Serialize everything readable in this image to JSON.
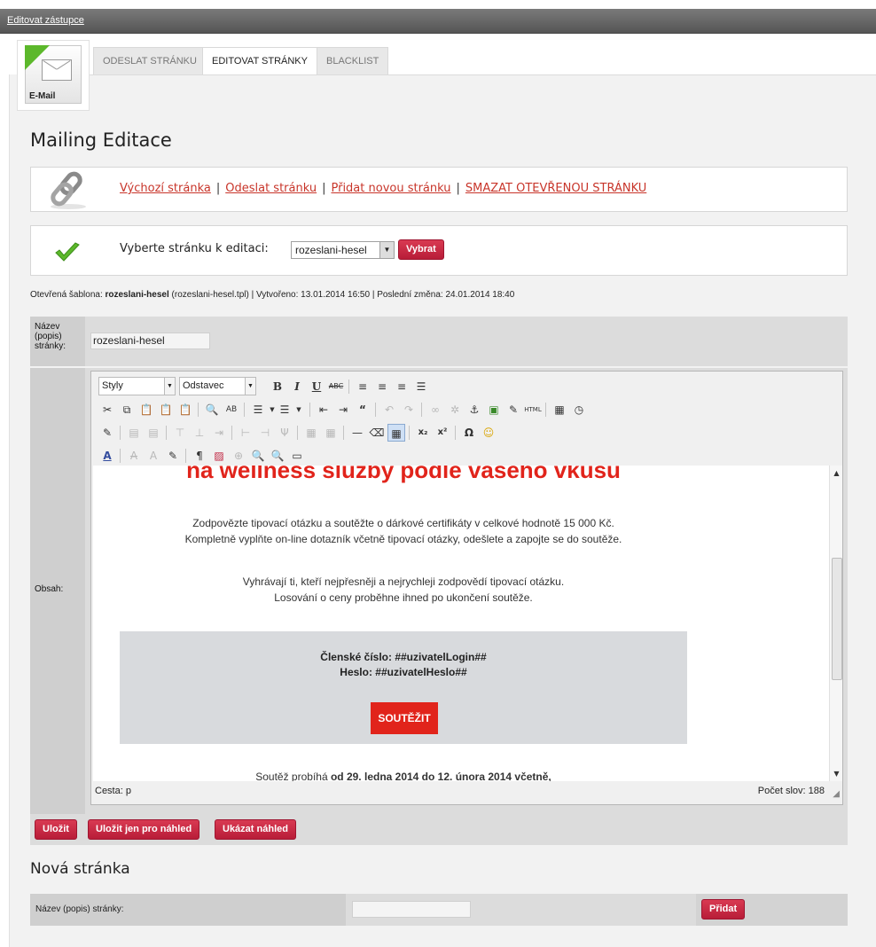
{
  "topbar": {
    "link": "Editovat zástupce"
  },
  "logo": {
    "label": "E-Mail"
  },
  "tabs": [
    {
      "label": "ODESLAT STRÁNKU",
      "active": false
    },
    {
      "label": "EDITOVAT STRÁNKY",
      "active": true
    },
    {
      "label": "BLACKLIST",
      "active": false
    }
  ],
  "page_title": "Mailing Editace",
  "links": {
    "items": [
      "Výchozí stránka",
      "Odeslat stránku",
      "Přidat novou stránku",
      "SMAZAT OTEVŘENOU STRÁNKU"
    ],
    "separator": "|"
  },
  "select_page": {
    "label": "Vyberte stránku k editaci:",
    "value": "rozeslani-hesel",
    "button": "Vybrat"
  },
  "info": {
    "label_template": "Otevřená šablona:",
    "template_name": "rozeslani-hesel",
    "template_file": "(rozeslani-hesel.tpl)",
    "created_label": "| Vytvořeno: 13.01.2014 16:50",
    "modified_label": "| Poslední změna: 24.01.2014 18:40"
  },
  "form": {
    "name_label": "Název (popis) stránky:",
    "name_value": "rozeslani-hesel",
    "content_label": "Obsah:"
  },
  "editor": {
    "styles_select": "Styly",
    "format_select": "Odstavec",
    "path": "Cesta: p",
    "word_count": "Počet slov: 188",
    "content": {
      "headline": "na wellness služby podle vašeho vkusu",
      "p1_line1": "Zodpovězte tipovací otázku a soutěžte o dárkové certifikáty v celkové hodnotě 15 000 Kč.",
      "p1_line2": "Kompletně vyplňte on-line dotazník včetně tipovací otázky, odešlete a zapojte se do soutěže.",
      "p2_line1": "Vyhrávají ti, kteří nejpřesněji a nejrychleji zodpovědí tipovací otázku.",
      "p2_line2": "Losování o ceny proběhne ihned po ukončení soutěže.",
      "member_line": "Členské číslo: ##uzivatelLogin##",
      "password_line": "Heslo: ##uzivatelHeslo##",
      "cta": "SOUTĚŽIT",
      "footer_prefix": "Soutěž probíhá ",
      "footer_bold": "od 29. ledna 2014 do 12. února 2014 včetně,"
    }
  },
  "buttons": {
    "save": "Uložit",
    "save_preview": "Uložit jen pro náhled",
    "show_preview": "Ukázat náhled"
  },
  "new_page": {
    "title": "Nová stránka",
    "label": "Název (popis) stránky:",
    "value": "",
    "button": "Přidat"
  },
  "colors": {
    "accent": "#c0233f",
    "link": "#c8352a",
    "headline": "#e1241b"
  }
}
